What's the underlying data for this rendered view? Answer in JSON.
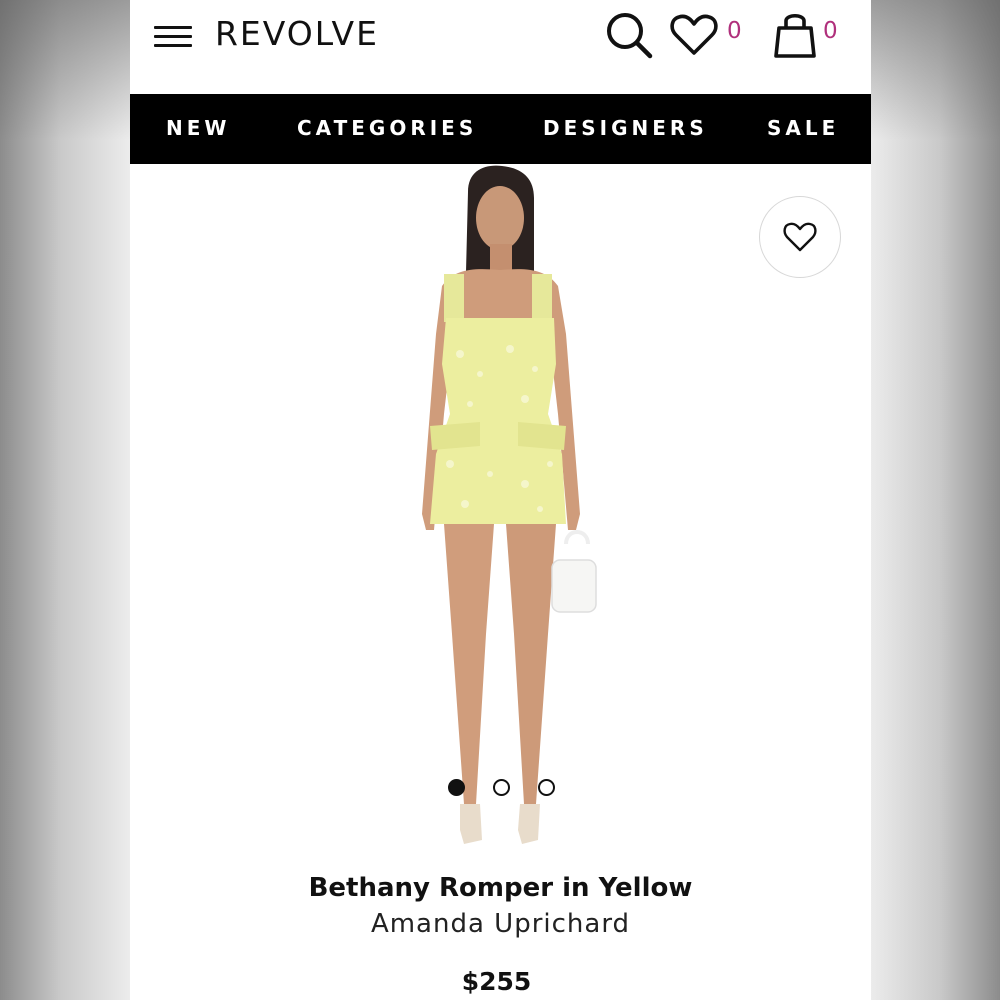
{
  "header": {
    "logo": "REVOLVE",
    "wishlist_count": "0",
    "bag_count": "0"
  },
  "nav": {
    "items": [
      {
        "label": "NEW"
      },
      {
        "label": "CATEGORIES"
      },
      {
        "label": "DESIGNERS"
      },
      {
        "label": "SALE"
      }
    ]
  },
  "product": {
    "name": "Bethany Romper in Yellow",
    "brand": "Amanda Uprichard",
    "price": "$255",
    "image_index": 1,
    "image_count": 3
  },
  "icons": [
    "menu-icon",
    "search-icon",
    "heart-icon",
    "shopping-bag-icon"
  ],
  "colors": {
    "nav_background": "#000000",
    "count_accent": "#b0307c",
    "dress": "#ecee9f"
  }
}
